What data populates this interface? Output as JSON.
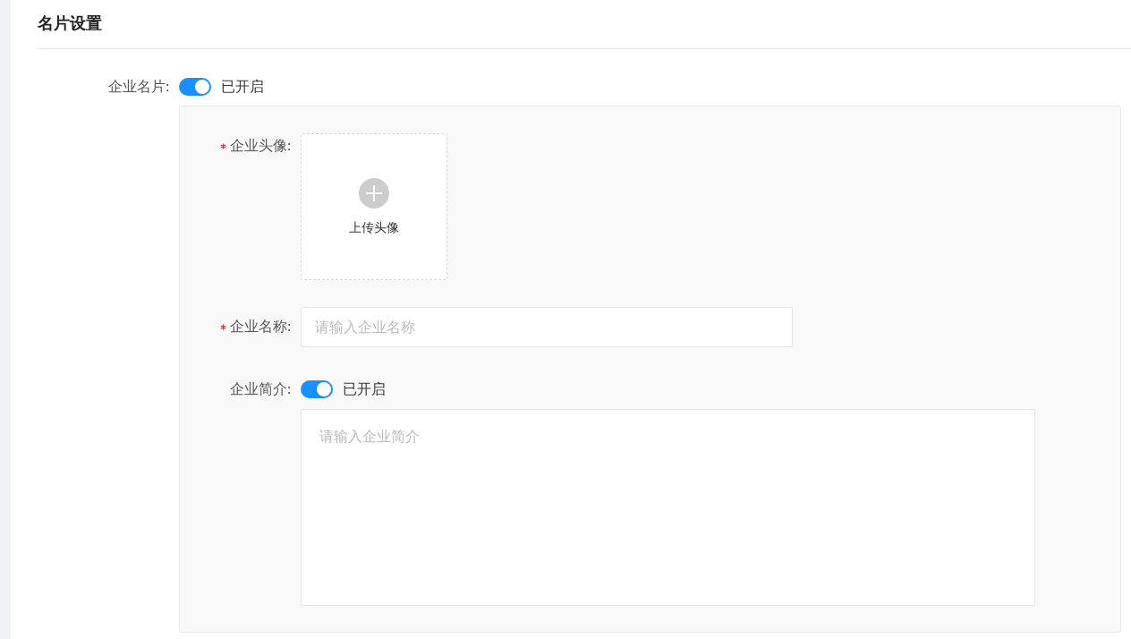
{
  "section": {
    "title": "名片设置"
  },
  "card_toggle": {
    "label": "企业名片:",
    "on": true,
    "status": "已开启"
  },
  "panel": {
    "fields": [
      {
        "kind": "upload",
        "label": "企业头像:",
        "required": true,
        "button_label": "上传头像"
      },
      {
        "kind": "input",
        "label": "企业名称:",
        "required": true,
        "placeholder": "请输入企业名称"
      },
      {
        "kind": "toggle_textarea",
        "label": "企业简介:",
        "required": false,
        "on": true,
        "status": "已开启",
        "placeholder": "请输入企业简介"
      }
    ]
  }
}
